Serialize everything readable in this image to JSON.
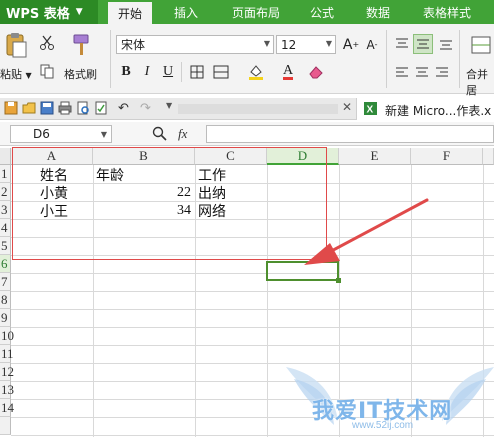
{
  "app": {
    "name": "WPS 表格"
  },
  "menu": [
    "开始",
    "插入",
    "页面布局",
    "公式",
    "数据",
    "表格样式"
  ],
  "ribbon": {
    "paste": "粘贴",
    "format_painter": "格式刷",
    "font_name": "宋体",
    "font_size": "12",
    "merge_center": "合并居"
  },
  "doc_tab": {
    "title": "新建 Micro...作表.x"
  },
  "formula_bar": {
    "name_box": "D6",
    "fx": "fx",
    "value": ""
  },
  "columns": [
    "A",
    "B",
    "C",
    "D",
    "E",
    "F"
  ],
  "rows": [
    "1",
    "2",
    "3",
    "4",
    "5",
    "6",
    "7",
    "8",
    "9",
    "10",
    "11",
    "12",
    "13",
    "14"
  ],
  "cells": {
    "a1": "姓名",
    "b1": "年龄",
    "c1": "工作",
    "a2": "小黄",
    "b2": "22",
    "c2": "出纳",
    "a3": "小王",
    "b3": "34",
    "c3": "网络"
  },
  "selected_cell": "D6",
  "colors": {
    "accent": "#41a337",
    "annotation": "#e04a4a",
    "selection": "#4e8f2e"
  },
  "watermark": {
    "text": "我爱IT技术网",
    "url": "www.52ij.com"
  }
}
